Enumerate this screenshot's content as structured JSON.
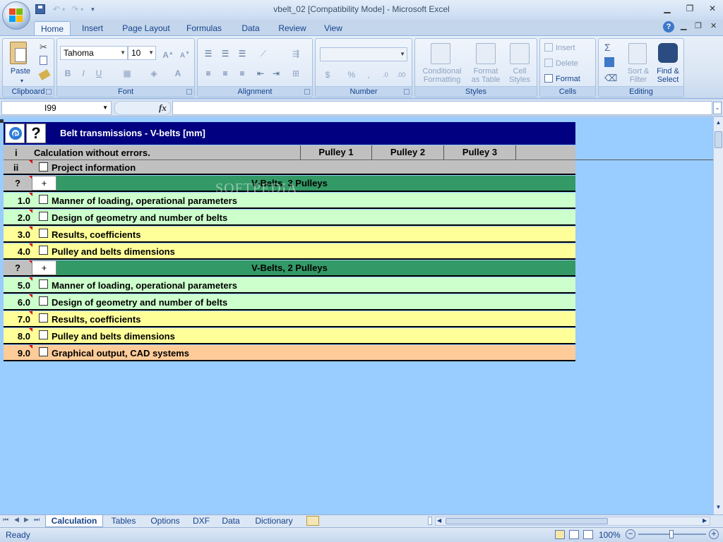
{
  "window": {
    "title": "vbelt_02  [Compatibility Mode] - Microsoft Excel",
    "minimize": "▁",
    "restore": "❐",
    "close": "✕"
  },
  "ribbon_tabs": [
    "Home",
    "Insert",
    "Page Layout",
    "Formulas",
    "Data",
    "Review",
    "View"
  ],
  "ribbon": {
    "clipboard": {
      "label": "Clipboard",
      "paste": "Paste"
    },
    "font": {
      "label": "Font",
      "name": "Tahoma",
      "size": "10"
    },
    "alignment": {
      "label": "Alignment"
    },
    "number": {
      "label": "Number",
      "format": "",
      "currency": "$",
      "percent": "%",
      "comma": ","
    },
    "styles": {
      "label": "Styles",
      "conditional": "Conditional\nFormatting",
      "format_table": "Format\nas Table",
      "cell_styles": "Cell\nStyles"
    },
    "cells": {
      "label": "Cells",
      "insert": "Insert",
      "delete": "Delete",
      "format": "Format"
    },
    "editing": {
      "label": "Editing",
      "sort_filter": "Sort &\nFilter",
      "find_select": "Find &\nSelect"
    }
  },
  "formula_bar": {
    "name_box": "I99",
    "fx": "fx",
    "value": ""
  },
  "sheet": {
    "header": {
      "title": "Belt transmissions - V-belts [mm]",
      "q_button": "?"
    },
    "status_row": {
      "idx": "i",
      "text": "Calculation without errors.",
      "columns": [
        "Pulley 1",
        "Pulley 2",
        "Pulley 3"
      ]
    },
    "project_row": {
      "idx": "ii",
      "text": "Project information"
    },
    "sections": [
      {
        "idx": "?",
        "expand": "+",
        "title": "V-Belts, 3 Pulleys",
        "rows": [
          {
            "num": "1.0",
            "text": "Manner of loading, operational parameters",
            "color": "#ccffcc"
          },
          {
            "num": "2.0",
            "text": "Design of geometry and number of belts",
            "color": "#ccffcc"
          },
          {
            "num": "3.0",
            "text": "Results, coefficients",
            "color": "#ffff99"
          },
          {
            "num": "4.0",
            "text": "Pulley and belts dimensions",
            "color": "#ffff99"
          }
        ]
      },
      {
        "idx": "?",
        "expand": "+",
        "title": "V-Belts, 2 Pulleys",
        "rows": [
          {
            "num": "5.0",
            "text": "Manner of loading, operational parameters",
            "color": "#ccffcc"
          },
          {
            "num": "6.0",
            "text": "Design of geometry and number of belts",
            "color": "#ccffcc"
          },
          {
            "num": "7.0",
            "text": "Results, coefficients",
            "color": "#ffff99"
          },
          {
            "num": "8.0",
            "text": "Pulley and belts dimensions",
            "color": "#ffff99"
          }
        ]
      }
    ],
    "final_row": {
      "num": "9.0",
      "text": "Graphical output, CAD systems",
      "color": "#ffcc99"
    },
    "watermark": "SOFTPEDIA"
  },
  "sheet_tabs": [
    "Calculation",
    "Tables",
    "Options",
    "DXF",
    "Data",
    "Dictionary"
  ],
  "status": {
    "ready": "Ready",
    "zoom": "100%"
  },
  "colors": {
    "section": "#339966",
    "header": "#000080",
    "grey": "#c0c0c0",
    "sheet": "#99ccff"
  }
}
